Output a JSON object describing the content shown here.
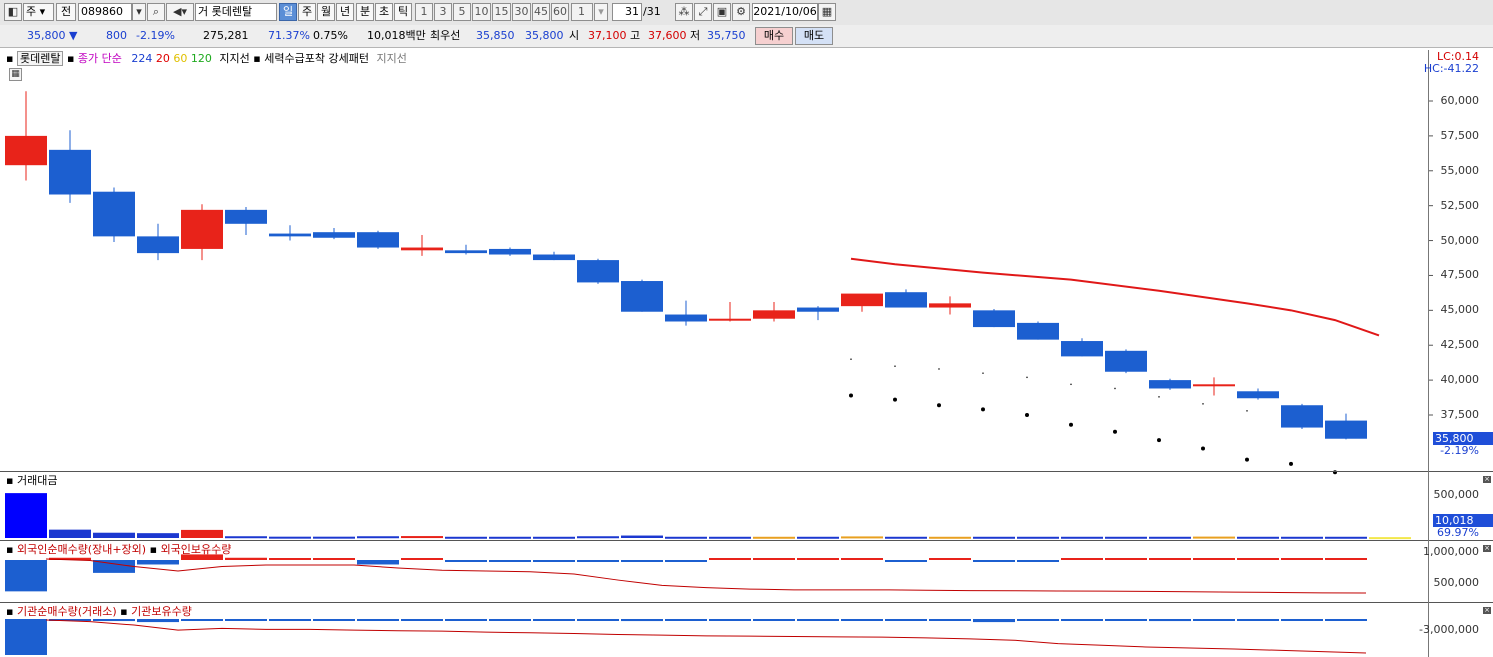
{
  "toolbar": {
    "mode": "주",
    "all": "전",
    "code": "089860",
    "name_prefix": "거",
    "name": "롯데렌탈",
    "periods": [
      "일",
      "주",
      "월",
      "년",
      "분",
      "초",
      "틱"
    ],
    "numbers": [
      "1",
      "3",
      "5",
      "10",
      "15",
      "30",
      "45",
      "60"
    ],
    "count": "1",
    "range": "31",
    "range_total": "/31",
    "date": "2021/10/06"
  },
  "quote": {
    "price": "35,800",
    "change": "800",
    "change_pct": "-2.19%",
    "volume": "275,281",
    "turnover": "71.37%",
    "ratio": "0.75%",
    "amount": "10,018백만",
    "best_label": "최우선",
    "ask": "35,850",
    "bid": "35,800",
    "open_label": "시",
    "open": "37,100",
    "high_label": "고",
    "high": "37,600",
    "low_label": "저",
    "low": "35,750",
    "buy": "매수",
    "sell": "매도"
  },
  "price_panel": {
    "name": "롯데렌탈",
    "ma_label": "종가 단순",
    "ma_periods": [
      "224",
      "20",
      "60",
      "120"
    ],
    "support": "지지선",
    "pattern": "세력수급포착 강세패턴",
    "support2": "지지선",
    "lc": "LC:0.14",
    "hc": "HC:-41.22",
    "last": "35,800",
    "last_pct": "-2.19%"
  },
  "amount_panel": {
    "title": "거래대금",
    "ticks": [
      "500,000"
    ],
    "last": "10,018",
    "last_pct": "69.97%"
  },
  "foreign_panel": {
    "title1": "외국인순매수량(장내+장외)",
    "title2": "외국인보유수량",
    "ticks": [
      "1,000,000",
      "500,000"
    ]
  },
  "inst_panel": {
    "title1": "기관순매수량(거래소)",
    "title2": "기관보유수량",
    "ticks": [
      "-3,000,000"
    ]
  },
  "chart_data": {
    "type": "candlestick",
    "y_ticks": [
      "60,000",
      "57,500",
      "55,000",
      "52,500",
      "50,000",
      "47,500",
      "45,000",
      "42,500",
      "40,000",
      "37,500"
    ],
    "ylim": [
      34000,
      61500
    ],
    "colors": {
      "up": "#e8231a",
      "down": "#1c5fd0",
      "ma": "#e01818"
    },
    "candles": [
      {
        "o": 55400,
        "h": 60700,
        "l": 54300,
        "c": 57500
      },
      {
        "o": 56500,
        "h": 57900,
        "l": 52700,
        "c": 53300
      },
      {
        "o": 53500,
        "h": 53800,
        "l": 49900,
        "c": 50300
      },
      {
        "o": 50300,
        "h": 51200,
        "l": 48600,
        "c": 49100
      },
      {
        "o": 49400,
        "h": 52600,
        "l": 48600,
        "c": 52200
      },
      {
        "o": 52200,
        "h": 52400,
        "l": 50400,
        "c": 51200
      },
      {
        "o": 50500,
        "h": 51100,
        "l": 50000,
        "c": 50300
      },
      {
        "o": 50600,
        "h": 50900,
        "l": 50100,
        "c": 50200
      },
      {
        "o": 50600,
        "h": 50700,
        "l": 49400,
        "c": 49500
      },
      {
        "o": 49300,
        "h": 50400,
        "l": 48900,
        "c": 49500
      },
      {
        "o": 49300,
        "h": 49700,
        "l": 49000,
        "c": 49100
      },
      {
        "o": 49400,
        "h": 49500,
        "l": 48900,
        "c": 49000
      },
      {
        "o": 49000,
        "h": 49200,
        "l": 48600,
        "c": 48600
      },
      {
        "o": 48600,
        "h": 48700,
        "l": 46900,
        "c": 47000
      },
      {
        "o": 47100,
        "h": 47200,
        "l": 44900,
        "c": 44900
      },
      {
        "o": 44700,
        "h": 45700,
        "l": 43900,
        "c": 44200
      },
      {
        "o": 44400,
        "h": 45600,
        "l": 44200,
        "c": 44400
      },
      {
        "o": 44400,
        "h": 45600,
        "l": 44200,
        "c": 45000
      },
      {
        "o": 45200,
        "h": 45300,
        "l": 44300,
        "c": 44900
      },
      {
        "o": 45300,
        "h": 46000,
        "l": 44900,
        "c": 46200
      },
      {
        "o": 46300,
        "h": 46500,
        "l": 45200,
        "c": 45200
      },
      {
        "o": 45200,
        "h": 46000,
        "l": 44700,
        "c": 45500
      },
      {
        "o": 45000,
        "h": 45100,
        "l": 43800,
        "c": 43800
      },
      {
        "o": 44100,
        "h": 44200,
        "l": 42900,
        "c": 42900
      },
      {
        "o": 42800,
        "h": 43000,
        "l": 41700,
        "c": 41700
      },
      {
        "o": 42100,
        "h": 42200,
        "l": 40500,
        "c": 40600
      },
      {
        "o": 40000,
        "h": 40100,
        "l": 39300,
        "c": 39400
      },
      {
        "o": 39600,
        "h": 40200,
        "l": 38900,
        "c": 39700
      },
      {
        "o": 39200,
        "h": 39400,
        "l": 38600,
        "c": 38700
      },
      {
        "o": 38200,
        "h": 38300,
        "l": 36500,
        "c": 36600
      },
      {
        "o": 37100,
        "h": 37600,
        "l": 35750,
        "c": 35800
      }
    ],
    "ma_line": [
      {
        "i": 19,
        "v": 48700
      },
      {
        "i": 20,
        "v": 48300
      },
      {
        "i": 22,
        "v": 47700
      },
      {
        "i": 24,
        "v": 47200
      },
      {
        "i": 26,
        "v": 46400
      },
      {
        "i": 28,
        "v": 45500
      },
      {
        "i": 29,
        "v": 45000
      },
      {
        "i": 30,
        "v": 44300
      },
      {
        "i": 31,
        "v": 43200
      }
    ],
    "upper_marks": [
      {
        "i": 19,
        "v": 41500
      },
      {
        "i": 20,
        "v": 41000
      },
      {
        "i": 21,
        "v": 40800
      },
      {
        "i": 22,
        "v": 40500
      },
      {
        "i": 23,
        "v": 40200
      },
      {
        "i": 24,
        "v": 39700
      },
      {
        "i": 25,
        "v": 39400
      },
      {
        "i": 26,
        "v": 38800
      },
      {
        "i": 27,
        "v": 38300
      },
      {
        "i": 28,
        "v": 37800
      }
    ],
    "support_dots": [
      {
        "i": 19,
        "v": 38900
      },
      {
        "i": 20,
        "v": 38600
      },
      {
        "i": 21,
        "v": 38200
      },
      {
        "i": 22,
        "v": 37900
      },
      {
        "i": 23,
        "v": 37500
      },
      {
        "i": 24,
        "v": 36800
      },
      {
        "i": 25,
        "v": 36300
      },
      {
        "i": 26,
        "v": 35700
      },
      {
        "i": 27,
        "v": 35100
      },
      {
        "i": 28,
        "v": 34300
      },
      {
        "i": 29,
        "v": 34000
      },
      {
        "i": 30,
        "v": 33400
      }
    ],
    "amount": [
      {
        "v": 510000,
        "c": "#0000ff"
      },
      {
        "v": 95000,
        "c": "#1c38d0"
      },
      {
        "v": 60000,
        "c": "#1c38d0"
      },
      {
        "v": 55000,
        "c": "#1c38d0"
      },
      {
        "v": 92000,
        "c": "#e8231a"
      },
      {
        "v": 20000,
        "c": "#1c38d0"
      },
      {
        "v": 15000,
        "c": "#1c38d0"
      },
      {
        "v": 15000,
        "c": "#1c38d0"
      },
      {
        "v": 20000,
        "c": "#1c38d0"
      },
      {
        "v": 22000,
        "c": "#e8231a"
      },
      {
        "v": 14000,
        "c": "#1c38d0"
      },
      {
        "v": 14000,
        "c": "#1c38d0"
      },
      {
        "v": 14000,
        "c": "#1c38d0"
      },
      {
        "v": 20000,
        "c": "#1c38d0"
      },
      {
        "v": 28000,
        "c": "#1c38d0"
      },
      {
        "v": 14000,
        "c": "#1c38d0"
      },
      {
        "v": 14000,
        "c": "#1c38d0"
      },
      {
        "v": 14000,
        "c": "#e8a020"
      },
      {
        "v": 14000,
        "c": "#1c38d0"
      },
      {
        "v": 18000,
        "c": "#e8a020"
      },
      {
        "v": 14000,
        "c": "#1c38d0"
      },
      {
        "v": 14000,
        "c": "#e8a020"
      },
      {
        "v": 14000,
        "c": "#1c38d0"
      },
      {
        "v": 14000,
        "c": "#1c38d0"
      },
      {
        "v": 14000,
        "c": "#1c38d0"
      },
      {
        "v": 14000,
        "c": "#1c38d0"
      },
      {
        "v": 14000,
        "c": "#1c38d0"
      },
      {
        "v": 16000,
        "c": "#e8a020"
      },
      {
        "v": 14000,
        "c": "#1c38d0"
      },
      {
        "v": 14000,
        "c": "#1c38d0"
      },
      {
        "v": 14000,
        "c": "#1c38d0"
      },
      {
        "v": 10018,
        "c": "#f2e74a"
      }
    ],
    "foreign_net": [
      -560000,
      40000,
      -230000,
      -80000,
      100000,
      40000,
      30000,
      20000,
      -80000,
      20000,
      -10000,
      -10000,
      -10000,
      -10000,
      -20000,
      -10000,
      10000,
      20000,
      10000,
      30000,
      -10000,
      10000,
      -10000,
      -10000,
      20000,
      20000,
      10000,
      10000,
      10000,
      10000,
      10000
    ],
    "foreign_hold": [
      1000000,
      980000,
      900000,
      840000,
      900000,
      920000,
      920000,
      920000,
      880000,
      850000,
      840000,
      830000,
      800000,
      720000,
      650000,
      620000,
      600000,
      590000,
      590000,
      590000,
      585000,
      580000,
      578000,
      575000,
      573000,
      570000,
      565000,
      560000,
      555000,
      550000,
      548000
    ],
    "inst_net": [
      -700000,
      -20000,
      -40000,
      -60000,
      -20000,
      -10000,
      -10000,
      -10000,
      -30000,
      -10000,
      -10000,
      -10000,
      -10000,
      -10000,
      -40000,
      -10000,
      -10000,
      -10000,
      -10000,
      -10000,
      -10000,
      -10000,
      -60000,
      -30000,
      -20000,
      -20000,
      -40000,
      -10000,
      -10000,
      -20000,
      -10000
    ],
    "inst_hold": [
      -2500000,
      -2550000,
      -2650000,
      -2800000,
      -2750000,
      -2780000,
      -2780000,
      -2800000,
      -2820000,
      -2830000,
      -2860000,
      -2880000,
      -2900000,
      -2930000,
      -2950000,
      -2970000,
      -2980000,
      -2990000,
      -3000000,
      -3010000,
      -3030000,
      -3060000,
      -3100000,
      -3200000,
      -3250000,
      -3300000,
      -3330000,
      -3360000,
      -3400000,
      -3440000,
      -3480000
    ]
  }
}
